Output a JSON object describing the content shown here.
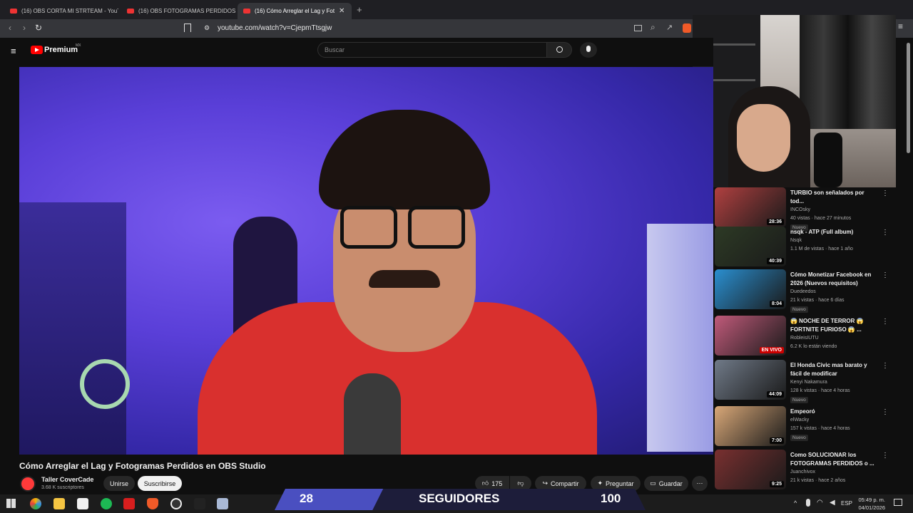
{
  "browser": {
    "tabs": [
      {
        "label": "(16) OBS CORTA MI STRTEAM - YouT"
      },
      {
        "label": "(16) OBS FOTOGRAMAS PERDIDOS F"
      },
      {
        "label": "(16) Cómo Arreglar el Lag y Foto",
        "active": true
      }
    ],
    "new_tab": "+",
    "url": "youtube.com/watch?v=CjepmTtsgjw"
  },
  "youtube": {
    "logo": "Premium",
    "region": "MX",
    "search_placeholder": "Buscar"
  },
  "video": {
    "title": "Cómo Arreglar el Lag y Fotogramas Perdidos en OBS Studio",
    "channel": "Taller CoverCade",
    "subscribers": "3.68 K suscriptores",
    "join_label": "Unirse",
    "subscribe_label": "Suscribirse",
    "likes": "175",
    "share_label": "Compartir",
    "ask_label": "Preguntar",
    "save_label": "Guardar",
    "more": "⋯"
  },
  "recommendations": [
    {
      "title": "TURBIO son señalados por tod...",
      "channel": "INCOsky",
      "meta": "40 vistas · hace 27 minutos",
      "badge": "Nuevo",
      "duration": "28:36",
      "thumb_color": "#b04040"
    },
    {
      "title": "nsqk - ATP (Full album)",
      "channel": "Nsqk",
      "meta": "1.1 M de vistas · hace 1 año",
      "badge": "",
      "duration": "40:39",
      "thumb_color": "#2d3a25"
    },
    {
      "title": "Cómo Monetizar Facebook en 2026 (Nuevos requisitos)",
      "channel": "Duedeedos",
      "meta": "21 k vistas · hace 6 días",
      "badge": "Nuevo",
      "duration": "8:04",
      "thumb_color": "#2a8fd0"
    },
    {
      "title": "😱 NOCHE DE TERROR 😱 FORTNITE FURIOSO 😱 ...",
      "channel": "RobleisIUTU",
      "meta": "6.2 K lo están viendo",
      "badge": "",
      "duration": "EN VIVO",
      "thumb_color": "#c05a7a"
    },
    {
      "title": "El Honda Civic mas barato y fácil de modificar",
      "channel": "Kenyi Nakamura",
      "meta": "128 k vistas · hace 4 horas",
      "badge": "Nuevo",
      "duration": "44:09",
      "thumb_color": "#707a88"
    },
    {
      "title": "Empeoró",
      "channel": "elWacky",
      "meta": "157 k vistas · hace 4 horas",
      "badge": "Nuevo",
      "duration": "7:00",
      "thumb_color": "#d9a878"
    },
    {
      "title": "Como SOLUCIONAR  los FOTOGRAMAS PERDIDOS o ...",
      "channel": "Juanchivox",
      "meta": "21 k vistas · hace 2 años",
      "badge": "",
      "duration": "9:25",
      "thumb_color": "#7a3030"
    }
  ],
  "stream_overlay": {
    "left_count": "28",
    "label": "SEGUIDORES",
    "goal": "100"
  },
  "taskbar": {
    "lang": "ESP",
    "time": "05:49 p. m.",
    "date": "04/01/2026"
  },
  "colors": {
    "yt_red": "#ff0000",
    "overlay_blue": "#4a4fc0",
    "overlay_dark": "#1d1d3a"
  }
}
